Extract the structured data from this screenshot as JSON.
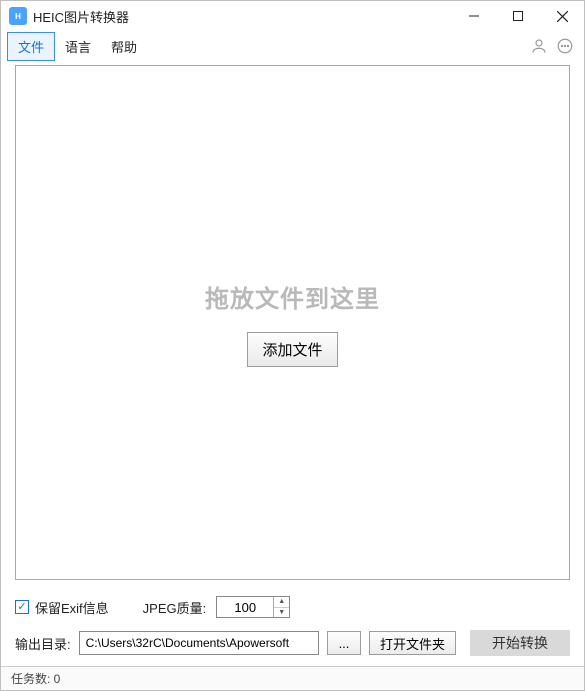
{
  "app": {
    "title": "HEIC图片转换器",
    "icon_label": "HEIC"
  },
  "menubar": {
    "file": "文件",
    "language": "语言",
    "help": "帮助"
  },
  "drop": {
    "hint": "拖放文件到这里",
    "add_button": "添加文件"
  },
  "options": {
    "exif_label": "保留Exif信息",
    "quality_label": "JPEG质量:",
    "quality_value": "100",
    "output_label": "输出目录:",
    "output_path": "C:\\Users\\32rC\\Documents\\Apowersoft",
    "browse": "...",
    "open_folder": "打开文件夹",
    "start": "开始转换"
  },
  "status": {
    "tasks_label": "任务数: 0"
  }
}
